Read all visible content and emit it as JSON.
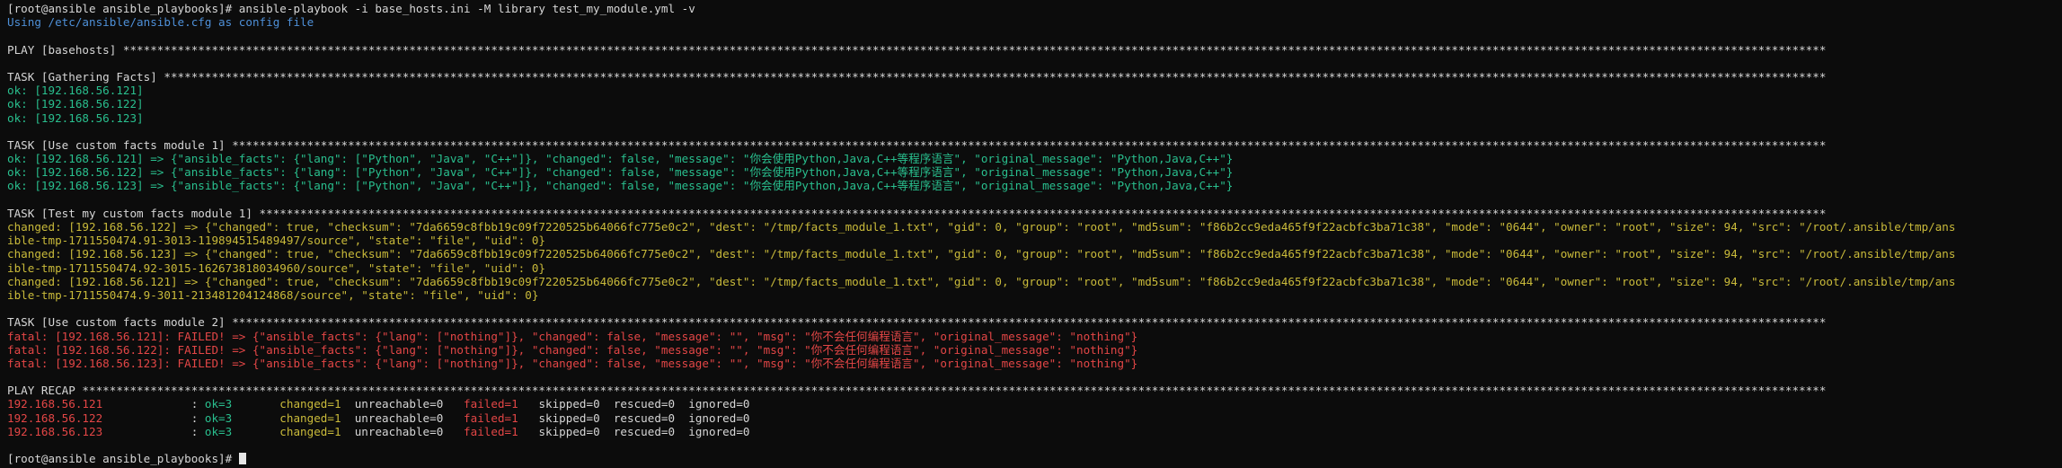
{
  "terminal": {
    "colors": {
      "background": "#0c0c0c",
      "default": "#d6d6d6",
      "ok": "#29bf8e",
      "changed": "#c9ba3a",
      "failed": "#e34646",
      "info": "#4e90d8"
    },
    "lines": [
      {
        "color": "white",
        "text": "[root@ansible ansible_playbooks]# ansible-playbook -i base_hosts.ini -M library test_my_module.yml -v"
      },
      {
        "color": "blue",
        "text": "Using /etc/ansible/ansible.cfg as config file"
      },
      {
        "color": "white",
        "text": ""
      },
      {
        "color": "white",
        "text": "PLAY [basehosts] **********************************************************************************************************************************************************************************************************************************************************"
      },
      {
        "color": "white",
        "text": ""
      },
      {
        "color": "white",
        "text": "TASK [Gathering Facts] ****************************************************************************************************************************************************************************************************************************************************"
      },
      {
        "color": "green",
        "text": "ok: [192.168.56.121]"
      },
      {
        "color": "green",
        "text": "ok: [192.168.56.122]"
      },
      {
        "color": "green",
        "text": "ok: [192.168.56.123]"
      },
      {
        "color": "white",
        "text": ""
      },
      {
        "color": "white",
        "text": "TASK [Use custom facts module 1] ******************************************************************************************************************************************************************************************************************************************"
      },
      {
        "color": "green",
        "text": "ok: [192.168.56.121] => {\"ansible_facts\": {\"lang\": [\"Python\", \"Java\", \"C++\"]}, \"changed\": false, \"message\": \"你会使用Python,Java,C++等程序语言\", \"original_message\": \"Python,Java,C++\"}"
      },
      {
        "color": "green",
        "text": "ok: [192.168.56.122] => {\"ansible_facts\": {\"lang\": [\"Python\", \"Java\", \"C++\"]}, \"changed\": false, \"message\": \"你会使用Python,Java,C++等程序语言\", \"original_message\": \"Python,Java,C++\"}"
      },
      {
        "color": "green",
        "text": "ok: [192.168.56.123] => {\"ansible_facts\": {\"lang\": [\"Python\", \"Java\", \"C++\"]}, \"changed\": false, \"message\": \"你会使用Python,Java,C++等程序语言\", \"original_message\": \"Python,Java,C++\"}"
      },
      {
        "color": "white",
        "text": ""
      },
      {
        "color": "white",
        "text": "TASK [Test my custom facts module 1] **************************************************************************************************************************************************************************************************************************************"
      },
      {
        "color": "yellow",
        "text": "changed: [192.168.56.122] => {\"changed\": true, \"checksum\": \"7da6659c8fbb19c09f7220525b64066fc775e0c2\", \"dest\": \"/tmp/facts_module_1.txt\", \"gid\": 0, \"group\": \"root\", \"md5sum\": \"f86b2cc9eda465f9f22acbfc3ba71c38\", \"mode\": \"0644\", \"owner\": \"root\", \"size\": 94, \"src\": \"/root/.ansible/tmp/ans"
      },
      {
        "color": "yellow",
        "text": "ible-tmp-1711550474.91-3013-119894515489497/source\", \"state\": \"file\", \"uid\": 0}"
      },
      {
        "color": "yellow",
        "text": "changed: [192.168.56.123] => {\"changed\": true, \"checksum\": \"7da6659c8fbb19c09f7220525b64066fc775e0c2\", \"dest\": \"/tmp/facts_module_1.txt\", \"gid\": 0, \"group\": \"root\", \"md5sum\": \"f86b2cc9eda465f9f22acbfc3ba71c38\", \"mode\": \"0644\", \"owner\": \"root\", \"size\": 94, \"src\": \"/root/.ansible/tmp/ans"
      },
      {
        "color": "yellow",
        "text": "ible-tmp-1711550474.92-3015-162673818034960/source\", \"state\": \"file\", \"uid\": 0}"
      },
      {
        "color": "yellow",
        "text": "changed: [192.168.56.121] => {\"changed\": true, \"checksum\": \"7da6659c8fbb19c09f7220525b64066fc775e0c2\", \"dest\": \"/tmp/facts_module_1.txt\", \"gid\": 0, \"group\": \"root\", \"md5sum\": \"f86b2cc9eda465f9f22acbfc3ba71c38\", \"mode\": \"0644\", \"owner\": \"root\", \"size\": 94, \"src\": \"/root/.ansible/tmp/ans"
      },
      {
        "color": "yellow",
        "text": "ible-tmp-1711550474.9-3011-213481204124868/source\", \"state\": \"file\", \"uid\": 0}"
      },
      {
        "color": "white",
        "text": ""
      },
      {
        "color": "white",
        "text": "TASK [Use custom facts module 2] ******************************************************************************************************************************************************************************************************************************************"
      },
      {
        "color": "red",
        "text": "fatal: [192.168.56.121]: FAILED! => {\"ansible_facts\": {\"lang\": [\"nothing\"]}, \"changed\": false, \"message\": \"\", \"msg\": \"你不会任何编程语言\", \"original_message\": \"nothing\"}"
      },
      {
        "color": "red",
        "text": "fatal: [192.168.56.122]: FAILED! => {\"ansible_facts\": {\"lang\": [\"nothing\"]}, \"changed\": false, \"message\": \"\", \"msg\": \"你不会任何编程语言\", \"original_message\": \"nothing\"}"
      },
      {
        "color": "red",
        "text": "fatal: [192.168.56.123]: FAILED! => {\"ansible_facts\": {\"lang\": [\"nothing\"]}, \"changed\": false, \"message\": \"\", \"msg\": \"你不会任何编程语言\", \"original_message\": \"nothing\"}"
      },
      {
        "color": "white",
        "text": ""
      },
      {
        "color": "white",
        "text": "PLAY RECAP ****************************************************************************************************************************************************************************************************************************************************************"
      }
    ],
    "recap": [
      {
        "host": "192.168.56.121",
        "sep": ": ",
        "ok": "ok=3",
        "changed": "changed=1",
        "unreachable": "unreachable=0",
        "failed": "failed=1",
        "skipped": "skipped=0",
        "rescued": "rescued=0",
        "ignored": "ignored=0"
      },
      {
        "host": "192.168.56.122",
        "sep": ": ",
        "ok": "ok=3",
        "changed": "changed=1",
        "unreachable": "unreachable=0",
        "failed": "failed=1",
        "skipped": "skipped=0",
        "rescued": "rescued=0",
        "ignored": "ignored=0"
      },
      {
        "host": "192.168.56.123",
        "sep": ": ",
        "ok": "ok=3",
        "changed": "changed=1",
        "unreachable": "unreachable=0",
        "failed": "failed=1",
        "skipped": "skipped=0",
        "rescued": "rescued=0",
        "ignored": "ignored=0"
      }
    ],
    "prompt": "[root@ansible ansible_playbooks]# "
  }
}
